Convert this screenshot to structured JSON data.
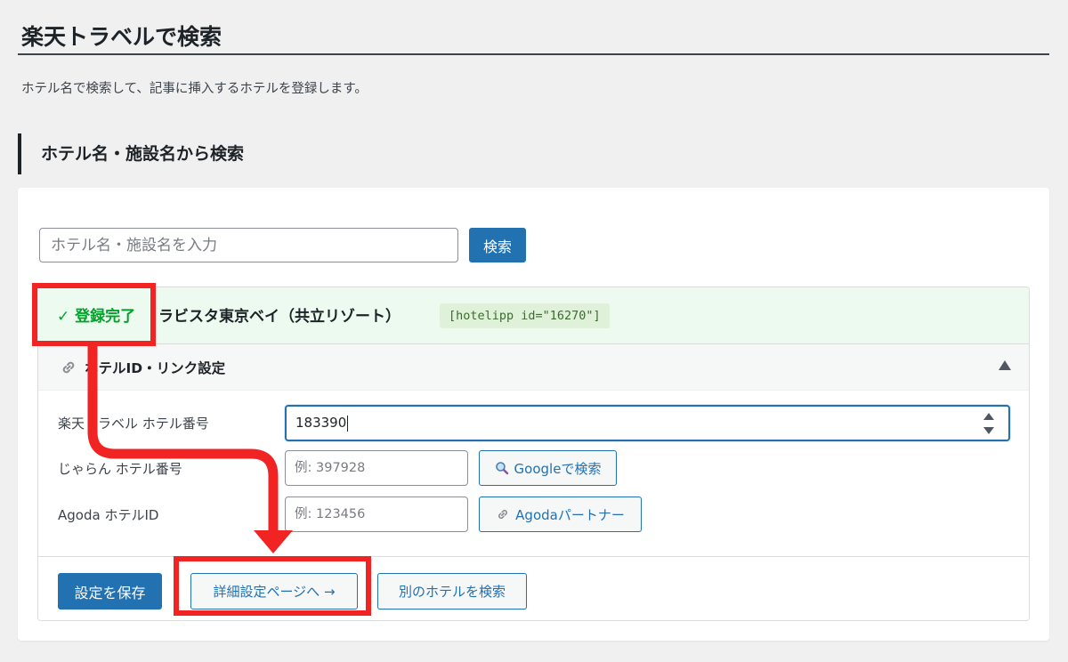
{
  "page": {
    "title": "楽天トラベルで検索",
    "description": "ホテル名で検索して、記事に挿入するホテルを登録します。"
  },
  "section": {
    "heading": "ホテル名・施設名から検索"
  },
  "search": {
    "placeholder": "ホテル名・施設名を入力",
    "button_label": "検索"
  },
  "result": {
    "status": "✓ 登録完了",
    "hotel_name": "ラビスタ東京ベイ（共立リゾート）",
    "shortcode": "[hotelipp id=\"16270\"]"
  },
  "settings": {
    "header_label": "ホテルID・リンク設定",
    "icons": {
      "link": "link-icon",
      "collapse": "collapse-up-icon",
      "search": "magnifier-icon"
    },
    "rakuten": {
      "label": "楽天トラベル ホテル番号",
      "value": "183390"
    },
    "jalan": {
      "label": "じゃらん ホテル番号",
      "placeholder": "例: 397928",
      "button_label": "Googleで検索"
    },
    "agoda": {
      "label": "Agoda ホテルID",
      "placeholder": "例: 123456",
      "button_label": "Agodaパートナー"
    }
  },
  "footer": {
    "save_label": "設定を保存",
    "detail_label": "詳細設定ページへ →",
    "other_label": "別のホテルを検索"
  },
  "colors": {
    "primary": "#2271b1",
    "success": "#00a32a",
    "success_bg": "#edfaef",
    "annotation": "#f22323"
  }
}
